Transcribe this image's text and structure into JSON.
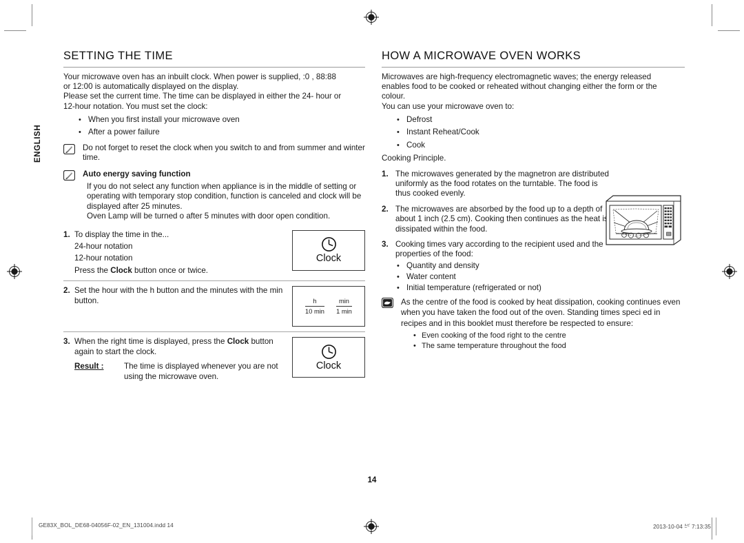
{
  "page": {
    "language_tab": "ENGLISH",
    "page_number": "14"
  },
  "left_column": {
    "title": "SETTING THE TIME",
    "intro_paragraph_1": "Your microwave oven has an inbuilt clock. When power is supplied,  :0 ,  88:88",
    "intro_paragraph_2": "or  12:00  is automatically displayed on the display.",
    "intro_paragraph_3": "Please set the current time. The time can be displayed in either the 24- hour or",
    "intro_paragraph_4": "12-hour notation. You must set the clock:",
    "bullets": [
      "When you first install your microwave oven",
      "After a power failure"
    ],
    "note_reset": "Do not forget to reset the clock when you switch to and from summer and winter time.",
    "note_auto_title": "Auto energy saving function",
    "note_auto_body_1": "If you do not select any function when appliance is in the middle of setting or operating with temporary stop condition, function is canceled and clock will be displayed after 25 minutes.",
    "note_auto_body_2": "Oven Lamp will be turned o   after 5 minutes with door open condition.",
    "steps": [
      {
        "number": "1.",
        "text": "To display the time in the...",
        "sub_lines": [
          "24-hour notation",
          "12-hour notation",
          "Press the Clock button once or twice."
        ],
        "sub_bold_word": "Clock",
        "figure": {
          "type": "clock-key",
          "icon": "clock-icon",
          "label": "Clock"
        }
      },
      {
        "number": "2.",
        "text": "Set the hour with the h button and the minutes with the min button.",
        "figure": {
          "type": "hmin-key",
          "left_top": "h",
          "left_bottom": "10 min",
          "right_top": "min",
          "right_bottom": "1 min"
        }
      },
      {
        "number": "3.",
        "text_before_bold": "When the right time is displayed, press the ",
        "bold_word": "Clock",
        "text_after_bold": " button again to start the clock.",
        "result_label": "Result :",
        "result_text": "The time is displayed whenever you are not using the microwave oven.",
        "figure": {
          "type": "clock-key",
          "icon": "clock-icon",
          "label": "Clock"
        }
      }
    ]
  },
  "right_column": {
    "title": "HOW A MICROWAVE OVEN WORKS",
    "intro_paragraph_1": "Microwaves are high-frequency electromagnetic waves; the energy released",
    "intro_paragraph_2": "enables food to be cooked or reheated without changing either the form or the",
    "intro_paragraph_3": "colour.",
    "intro_paragraph_4": "You can use your microwave oven to:",
    "bullets": [
      "Defrost",
      "Instant Reheat/Cook",
      "Cook"
    ],
    "cooking_principle": "Cooking Principle.",
    "steps": [
      {
        "number": "1.",
        "text": "The microwaves generated by the magnetron are distributed uniformly as the food rotates on the turntable. The food is thus cooked evenly."
      },
      {
        "number": "2.",
        "text": "The microwaves are absorbed by the food up to a depth of about 1 inch (2.5 cm). Cooking then continues as the heat is dissipated within the food."
      },
      {
        "number": "3.",
        "text": "Cooking times vary according to the recipient used and the properties of the food:"
      }
    ],
    "step3_bullets": [
      "Quantity and density",
      "Water content",
      "Initial temperature (refrigerated or not)"
    ],
    "note_hand": "As the centre of the food is cooked by heat dissipation, cooking continues even when you have taken the food out of the oven. Standing times speci ed in recipes and in this booklet must therefore be respected to ensure:",
    "note_hand_bullets": [
      "Even cooking of the food right to the centre",
      "The same temperature throughout the food"
    ],
    "figure_caption": "microwave-oven-diagram"
  },
  "footer": {
    "file_name": "GE83X_BOL_DE68-04056F-02_EN_131004.indd   14",
    "timestamp": "2013-10-04   ㍓ 7:13:35"
  },
  "colors": {
    "text": "#1a1a1a",
    "rule": "#9a9a9a",
    "box_border": "#3a3a3a",
    "note_icon": "#2b2b2b"
  }
}
